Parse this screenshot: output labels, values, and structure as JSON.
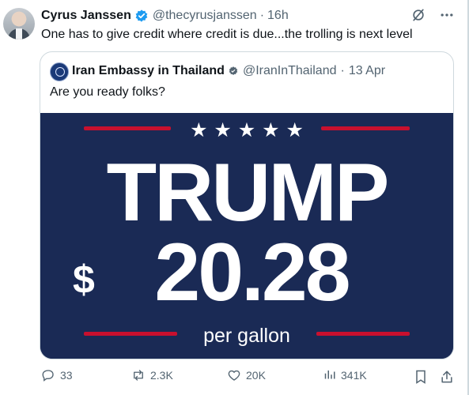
{
  "tweet": {
    "author_name": "Cyrus Janssen",
    "handle": "@thecyrusjanssen",
    "separator": "·",
    "time": "16h",
    "text": "One has to give credit where credit is due...the trolling is next level"
  },
  "quote": {
    "author_name": "Iran Embassy in Thailand",
    "handle": "@IranInThailand",
    "separator": "·",
    "date": "13 Apr",
    "text": "Are you ready folks?",
    "image": {
      "headline": "TRUMP",
      "dollar": "$",
      "price": "20.28",
      "unit": "per gallon",
      "stars": "★ ★ ★ ★ ★"
    }
  },
  "actions": {
    "replies": "33",
    "reposts": "2.3K",
    "likes": "20K",
    "views": "341K"
  },
  "colors": {
    "navy": "#1a2a55",
    "red": "#c8102e",
    "muted": "#536471",
    "verified": "#1d9bf0"
  }
}
